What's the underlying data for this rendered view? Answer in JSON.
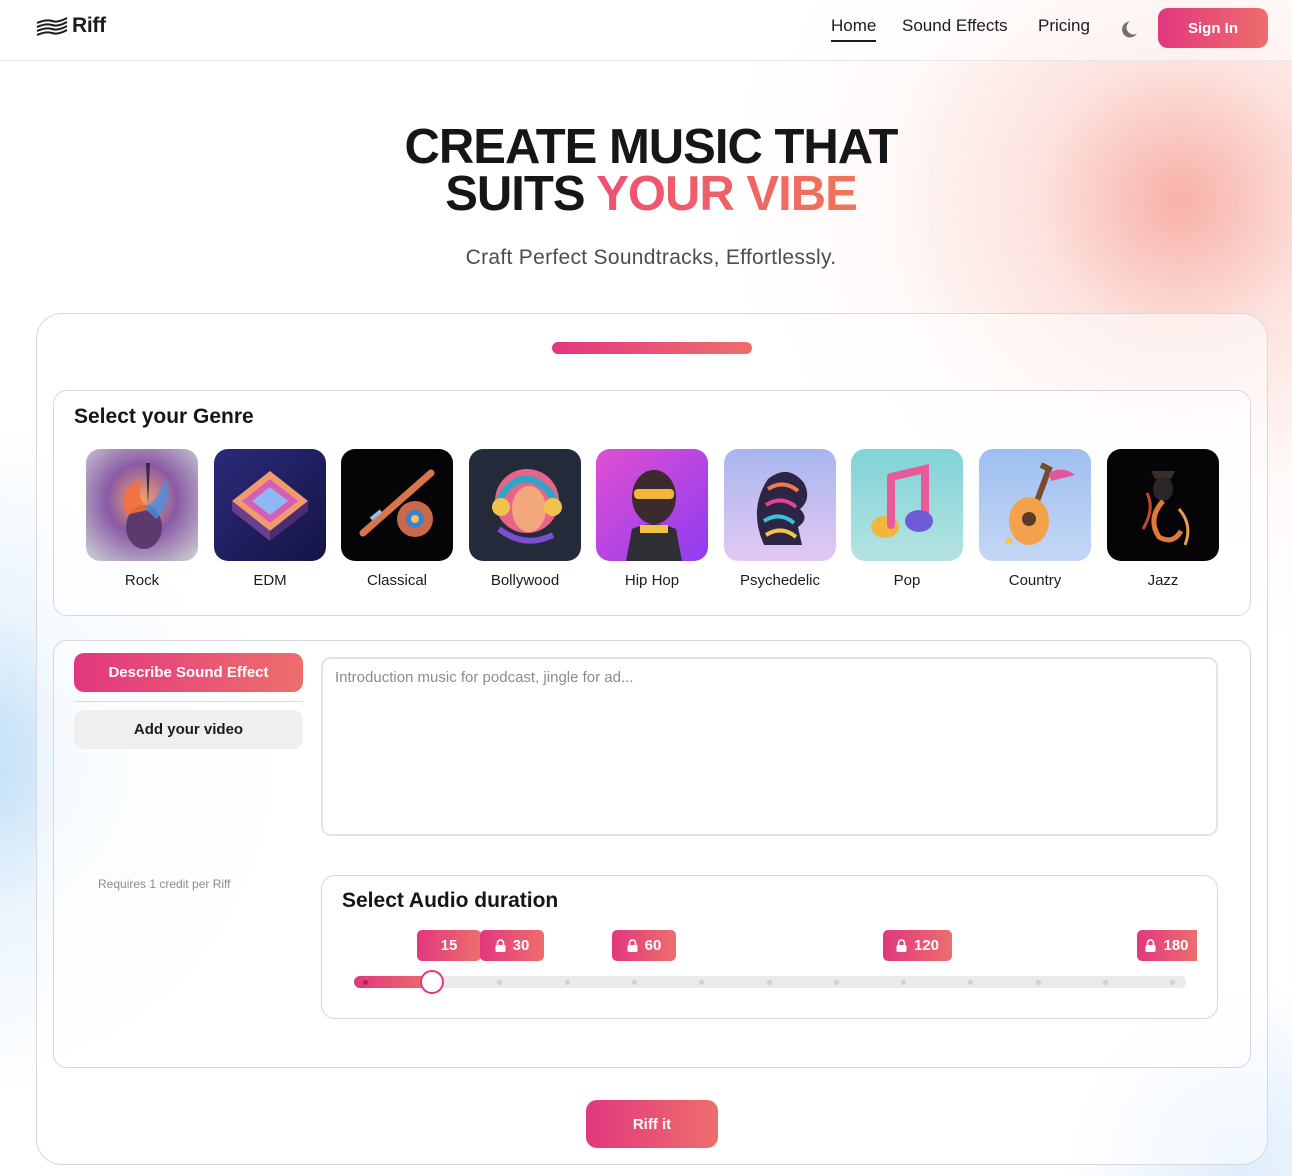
{
  "header": {
    "logo_text": "Riff",
    "nav": [
      {
        "label": "Home",
        "active": true
      },
      {
        "label": "Sound Effects",
        "active": false
      },
      {
        "label": "Pricing",
        "active": false
      }
    ],
    "theme_icon": "moon-icon",
    "sign_in_label": "Sign In"
  },
  "hero": {
    "title_line1": "CREATE MUSIC THAT",
    "title_line2_prefix": "SUITS ",
    "title_line2_accent": "YOUR VIBE",
    "subtitle": "Craft Perfect Soundtracks, Effortlessly."
  },
  "wizard": {
    "progress": 1.0,
    "genre_section": {
      "title": "Select your Genre",
      "genres": [
        {
          "label": "Rock"
        },
        {
          "label": "EDM"
        },
        {
          "label": "Classical"
        },
        {
          "label": "Bollywood"
        },
        {
          "label": "Hip Hop"
        },
        {
          "label": "Psychedelic"
        },
        {
          "label": "Pop"
        },
        {
          "label": "Country"
        },
        {
          "label": "Jazz"
        }
      ]
    },
    "tabs": {
      "describe_label": "Describe Sound Effect",
      "video_label": "Add your video"
    },
    "prompt": {
      "placeholder": "Introduction music for podcast, jingle for ad..."
    },
    "credit_note": "Requires 1 credit per Riff",
    "duration": {
      "title": "Select Audio duration",
      "options": [
        {
          "label": "15",
          "locked": false
        },
        {
          "label": "30",
          "locked": true
        },
        {
          "label": "60",
          "locked": true
        },
        {
          "label": "120",
          "locked": true
        },
        {
          "label": "180",
          "locked": true
        }
      ],
      "selected_value": 15
    },
    "submit_label": "Riff it"
  },
  "colors": {
    "accent_start": "#e1377f",
    "accent_end": "#ee6e6c",
    "text_dark": "#15161a"
  }
}
